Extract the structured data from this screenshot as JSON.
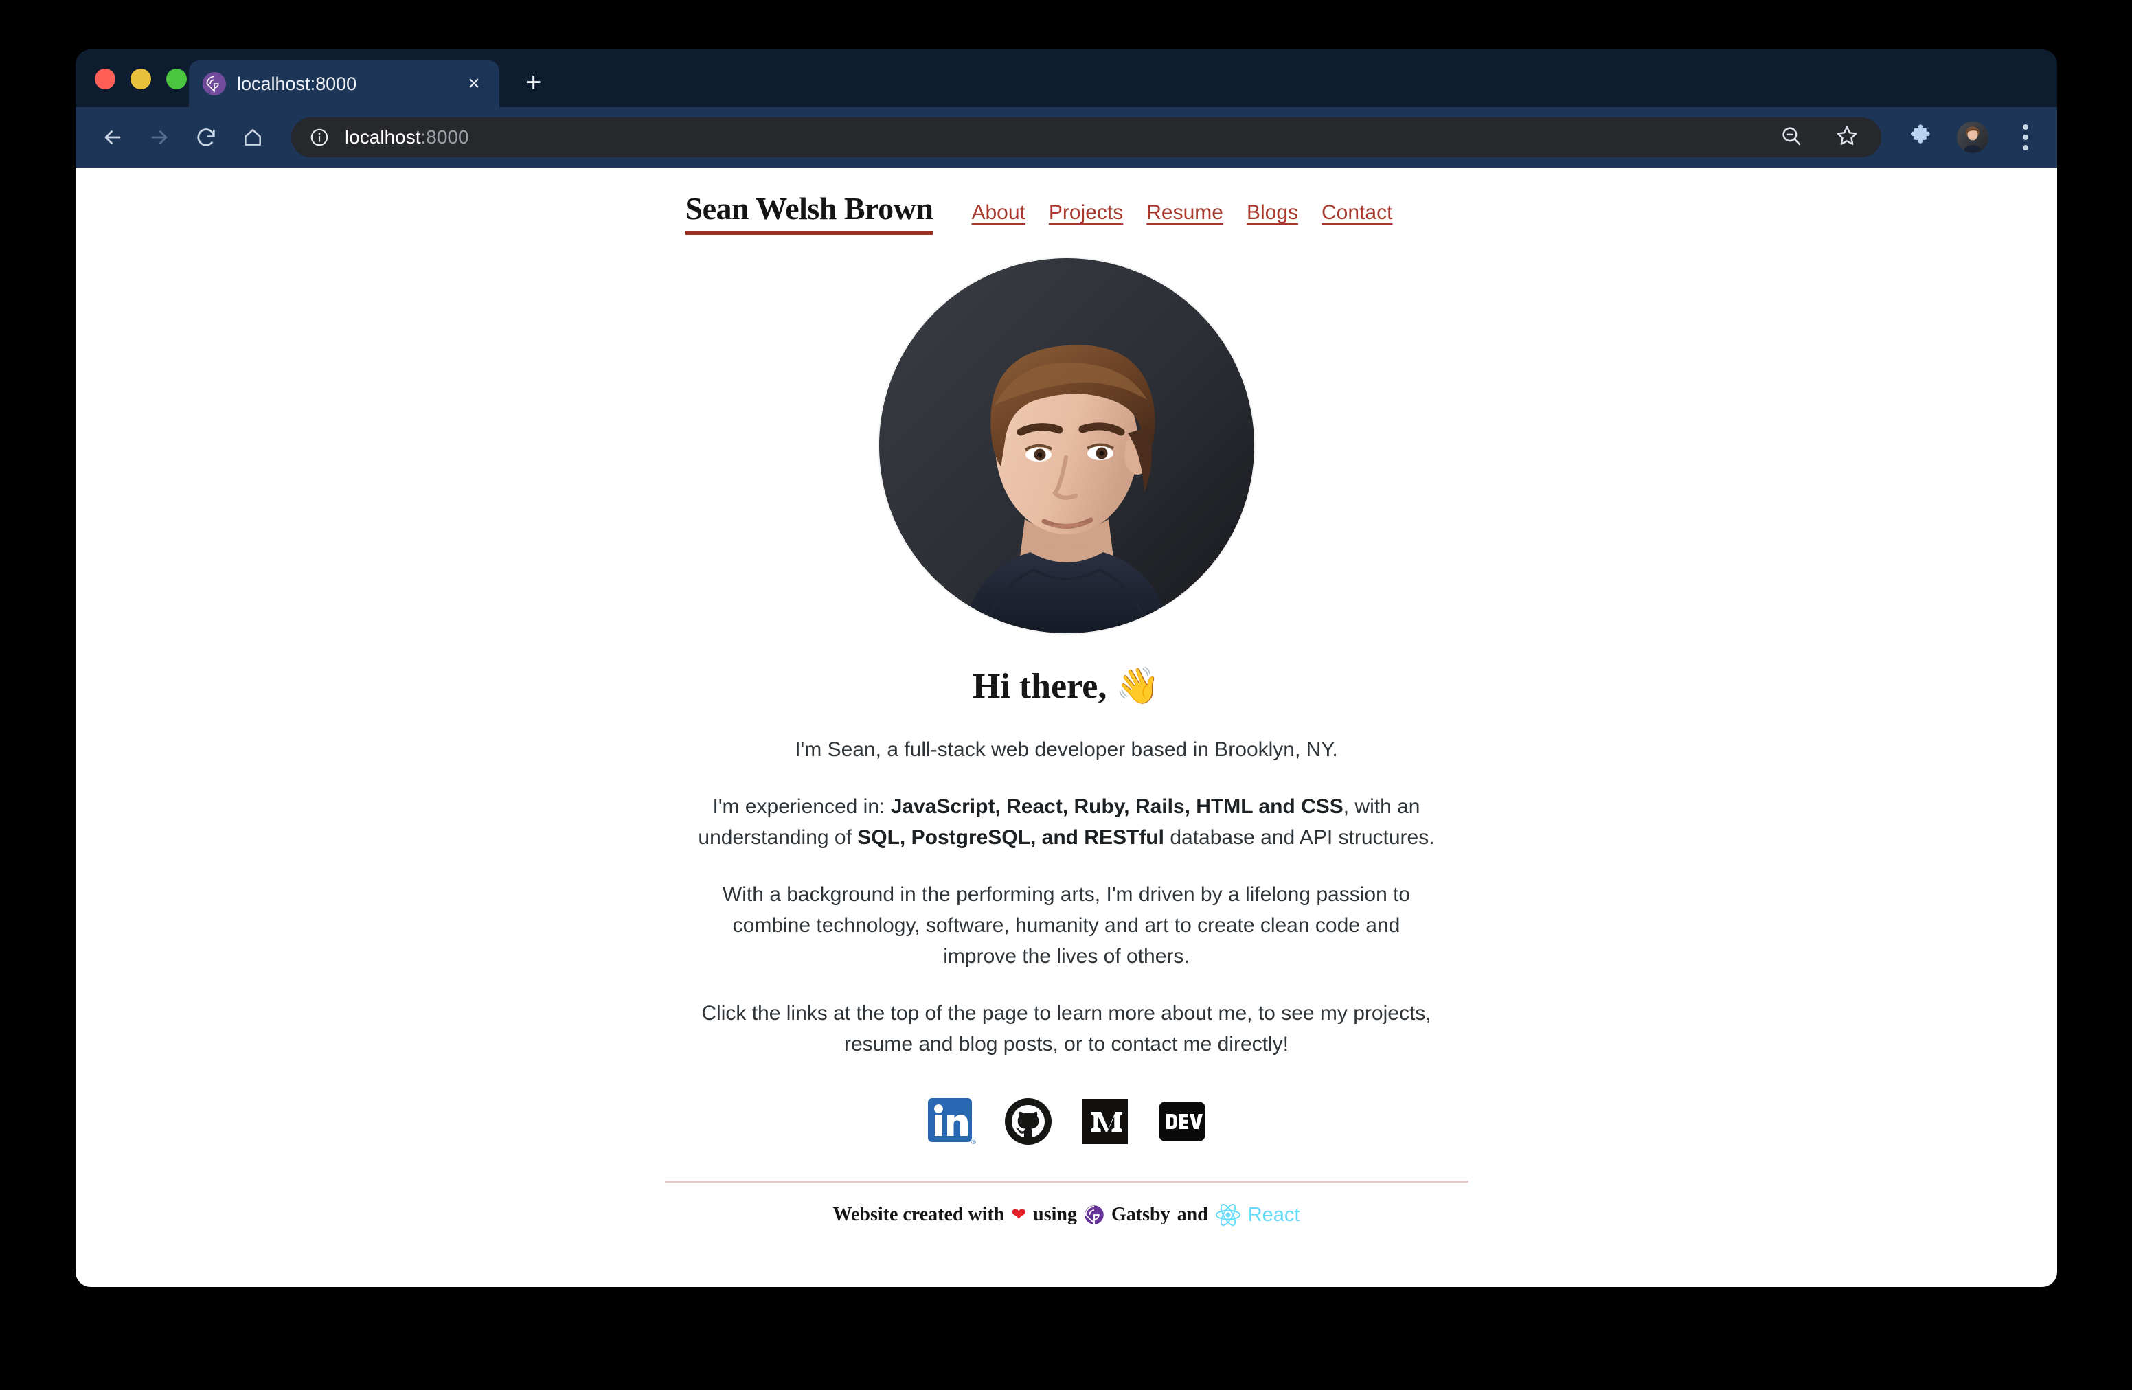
{
  "browser": {
    "tab": {
      "title": "localhost:8000",
      "favicon": "gatsby-icon",
      "close_label": "×"
    },
    "new_tab_label": "+",
    "omnibox": {
      "url_host": "localhost",
      "url_port": ":8000",
      "security_icon": "info-circle-icon"
    },
    "toolbar_icons": [
      "back-arrow-icon",
      "forward-arrow-icon",
      "reload-icon",
      "home-icon"
    ],
    "omnibox_icons": [
      "zoom-out-icon",
      "bookmark-star-icon"
    ],
    "right_icons": [
      "extensions-puzzle-icon",
      "profile-avatar",
      "three-dot-menu-icon"
    ],
    "colors": {
      "chrome_dark": "#0e1c30",
      "toolbar": "#1d3557",
      "tab_active": "#1d3557",
      "omnibox": "#26282b",
      "traffic_red": "#ff5f57",
      "traffic_yellow": "#e8c13c",
      "traffic_green": "#4cc540"
    }
  },
  "site": {
    "brand": "Sean Welsh Brown",
    "nav": [
      {
        "label": "About"
      },
      {
        "label": "Projects"
      },
      {
        "label": "Resume"
      },
      {
        "label": "Blogs"
      },
      {
        "label": "Contact"
      }
    ],
    "accent_color": "#a8392c",
    "brand_underline_color": "#9e3024",
    "portrait_alt": "portrait-photo",
    "greeting": "Hi there,",
    "greeting_emoji": "👋",
    "paragraphs": {
      "p1": "I'm Sean, a full-stack web developer based in Brooklyn, NY.",
      "p2_a": "I'm experienced in: ",
      "p2_b": "JavaScript, React, Ruby, Rails, HTML and CSS",
      "p2_c": ", with an understanding of ",
      "p2_d": "SQL, PostgreSQL, and RESTful",
      "p2_e": " database and API structures.",
      "p3": "With a background in the performing arts, I'm driven by a lifelong passion to combine technology, software, humanity and art to create clean code and improve the lives of others.",
      "p4": "Click the links at the top of the page to learn more about me, to see my projects, resume and blog posts, or to contact me directly!"
    },
    "socials": [
      {
        "name": "linkedin-icon",
        "color": "#2867b2"
      },
      {
        "name": "github-icon",
        "color": "#161614"
      },
      {
        "name": "medium-icon",
        "color": "#12100e"
      },
      {
        "name": "devto-icon",
        "color": "#0a0a0a"
      }
    ],
    "footer": {
      "text_before_heart": "Website created with",
      "heart": "❤",
      "using": "using",
      "gatsby": "Gatsby",
      "and": "and",
      "react": "React",
      "divider_color": "#e3c9c9",
      "react_color": "#61dafb",
      "gatsby_color": "#663399"
    }
  }
}
